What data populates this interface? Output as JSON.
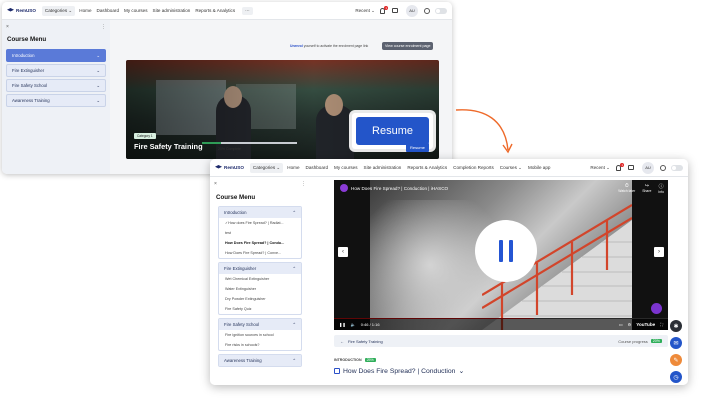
{
  "back_window": {
    "brand": "RemUSO",
    "nav": {
      "categories": "Categories ⌄",
      "items": [
        "Home",
        "Dashboard",
        "My courses",
        "Site administration",
        "Reports & Analytics"
      ],
      "more": "⋯",
      "recent": "Recent ⌄",
      "notification_count": "1",
      "avatar": "AU"
    },
    "sidebar": {
      "close_icon": "×",
      "menu_icon": "⋮",
      "title": "Course Menu",
      "sections": [
        {
          "label": "Introduction",
          "chevron": "⌄"
        },
        {
          "label": "Fire Extinguisher",
          "chevron": "⌄"
        },
        {
          "label": "Fire Safety School",
          "chevron": "⌄"
        },
        {
          "label": "Awareness Training",
          "chevron": "⌄"
        }
      ]
    },
    "enrol_link": "Unenrol",
    "enrol_text": " yourself to activate the enrolment page link",
    "view_enrolment_button": "View course enrolment page",
    "course": {
      "category_chip": "Category 1",
      "title": "Fire Safety Training",
      "resume_large": "Resume",
      "progress_percent": 20,
      "progress_text": "20% Complete",
      "resume_small": "Resume"
    }
  },
  "front_window": {
    "brand": "RemUSO",
    "nav": {
      "categories": "Categories ⌄",
      "items": [
        "Home",
        "Dashboard",
        "My courses",
        "Site administration",
        "Reports & Analytics",
        "Completion Reports",
        "Courses ⌄",
        "Mobile app"
      ],
      "recent": "Recent ⌄",
      "notification_count": "1",
      "avatar": "AU"
    },
    "sidebar": {
      "close_icon": "×",
      "menu_icon": "⋮",
      "title": "Course Menu",
      "groups": [
        {
          "label": "Introduction",
          "chevron": "⌃",
          "lessons": [
            "✓How does Fire Spread? | Radiat...",
            "test",
            "How Does Fire Spread? | Condu...",
            "How Does Fire Spread? | Conve..."
          ]
        },
        {
          "label": "Fire Extinguisher",
          "chevron": "⌃",
          "lessons": [
            "Wet Chemical Extinguisher",
            "Water Extinguisher",
            "Dry Powder Extinguisher",
            "Fire Safety Quiz"
          ]
        },
        {
          "label": "Fire Safety School",
          "chevron": "⌃",
          "lessons": [
            "Fire ignition sources in school",
            "Fire risks in schools?"
          ]
        },
        {
          "label": "Awareness Training",
          "chevron": "⌃",
          "lessons": []
        }
      ],
      "mini_button": "▸"
    },
    "video": {
      "title": "How Does Fire Spread? | Conduction | iHASCO",
      "actions": [
        {
          "icon": "⏱",
          "label": "Watch later"
        },
        {
          "icon": "↪",
          "label": "Share"
        },
        {
          "icon": "ⓘ",
          "label": "Info"
        }
      ],
      "prev": "‹",
      "next": "›",
      "time": "0:46 / 1:16",
      "progress_fraction": 0.6,
      "youtube_label": "YouTube"
    },
    "progress_row": {
      "course_name": "Fire Safety Training",
      "course_progress_label": "Course progress",
      "course_progress": "20%"
    },
    "section_label": "INTRODUCTION",
    "section_progress": "25%",
    "lesson_title": "How Does Fire Spread? | Conduction"
  },
  "colors": {
    "primary_blue": "#2355c9",
    "arrow": "#ee6a2a",
    "success": "#2fae5a",
    "sidebar_active": "#5a7ad8"
  }
}
